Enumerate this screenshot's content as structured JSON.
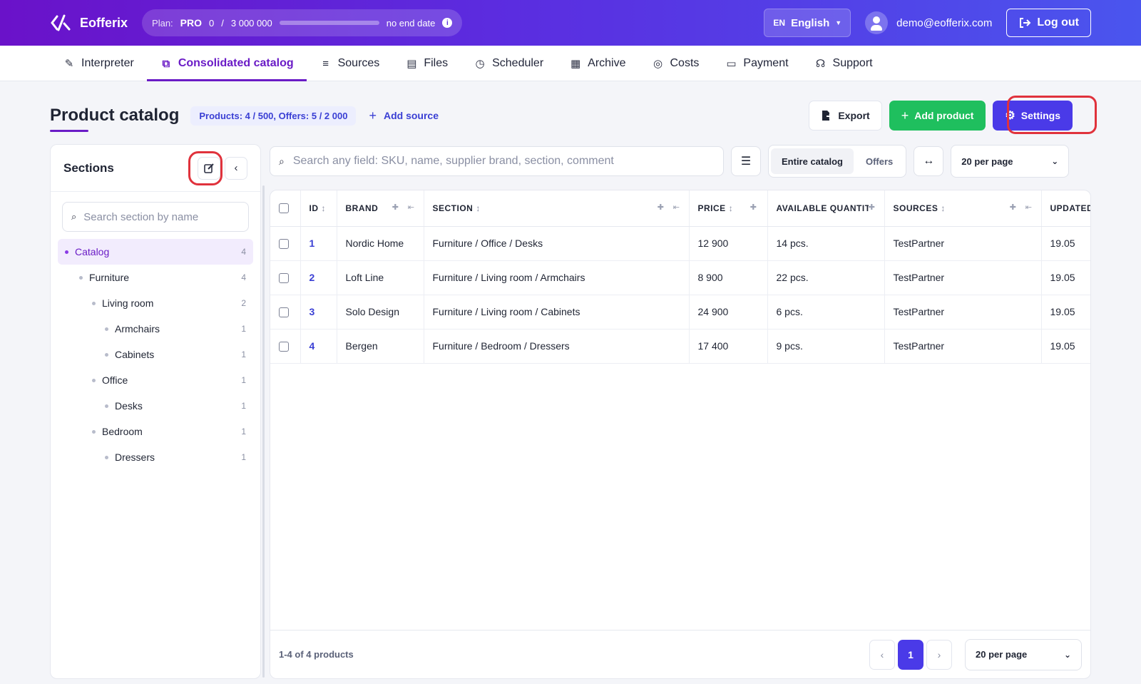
{
  "header": {
    "brand": "Eofferix",
    "plan_label": "Plan:",
    "plan_name": "PRO",
    "usage_used": "0",
    "usage_sep": "/",
    "usage_limit": "3 000 000",
    "usage_fraction": 0,
    "end_date": "no end date",
    "lang_code": "EN",
    "lang_name": "English",
    "user_email": "demo@eofferix.com",
    "logout_label": "Log out"
  },
  "nav": {
    "items": [
      {
        "label": "Interpreter",
        "icon": "wand-icon"
      },
      {
        "label": "Consolidated catalog",
        "icon": "sitemap-icon"
      },
      {
        "label": "Sources",
        "icon": "layers-icon"
      },
      {
        "label": "Files",
        "icon": "file-tree-icon"
      },
      {
        "label": "Scheduler",
        "icon": "clock-icon"
      },
      {
        "label": "Archive",
        "icon": "archive-icon"
      },
      {
        "label": "Costs",
        "icon": "coins-icon"
      },
      {
        "label": "Payment",
        "icon": "credit-card-icon"
      },
      {
        "label": "Support",
        "icon": "headset-icon"
      }
    ],
    "active_index": 1
  },
  "page": {
    "title": "Product catalog",
    "counts": "Products: 4 / 500, Offers: 5 / 2 000",
    "add_source": "Add source",
    "export_label": "Export",
    "add_product_label": "Add product",
    "settings_label": "Settings"
  },
  "sections": {
    "title": "Sections",
    "search_placeholder": "Search section by name",
    "tree": [
      {
        "label": "Catalog",
        "count": "4",
        "level": 0,
        "selected": true
      },
      {
        "label": "Furniture",
        "count": "4",
        "level": 1
      },
      {
        "label": "Living room",
        "count": "2",
        "level": 2
      },
      {
        "label": "Armchairs",
        "count": "1",
        "level": 3
      },
      {
        "label": "Cabinets",
        "count": "1",
        "level": 3
      },
      {
        "label": "Office",
        "count": "1",
        "level": 2
      },
      {
        "label": "Desks",
        "count": "1",
        "level": 3
      },
      {
        "label": "Bedroom",
        "count": "1",
        "level": 2
      },
      {
        "label": "Dressers",
        "count": "1",
        "level": 3
      }
    ]
  },
  "table": {
    "search_placeholder": "Search any field: SKU, name, supplier brand, section, comment",
    "scope_all": "Entire catalog",
    "scope_offers": "Offers",
    "per_page": "20 per page",
    "columns": [
      "ID",
      "BRAND",
      "SECTION",
      "PRICE",
      "AVAILABLE QUANTITY",
      "SOURCES",
      "UPDATED"
    ],
    "rows": [
      {
        "id": "1",
        "brand": "Nordic Home",
        "section": "Furniture / Office / Desks",
        "price": "12 900",
        "qty": "14 pcs.",
        "source": "TestPartner",
        "updated": "19.05"
      },
      {
        "id": "2",
        "brand": "Loft Line",
        "section": "Furniture / Living room / Armchairs",
        "price": "8 900",
        "qty": "22 pcs.",
        "source": "TestPartner",
        "updated": "19.05"
      },
      {
        "id": "3",
        "brand": "Solo Design",
        "section": "Furniture / Living room / Cabinets",
        "price": "24 900",
        "qty": "6 pcs.",
        "source": "TestPartner",
        "updated": "19.05"
      },
      {
        "id": "4",
        "brand": "Bergen",
        "section": "Furniture / Bedroom / Dressers",
        "price": "17 400",
        "qty": "9 pcs.",
        "source": "TestPartner",
        "updated": "19.05"
      }
    ],
    "footer_text": "1-4 of 4 products",
    "current_page": "1",
    "prev_symbol": "‹",
    "next_symbol": "›"
  }
}
